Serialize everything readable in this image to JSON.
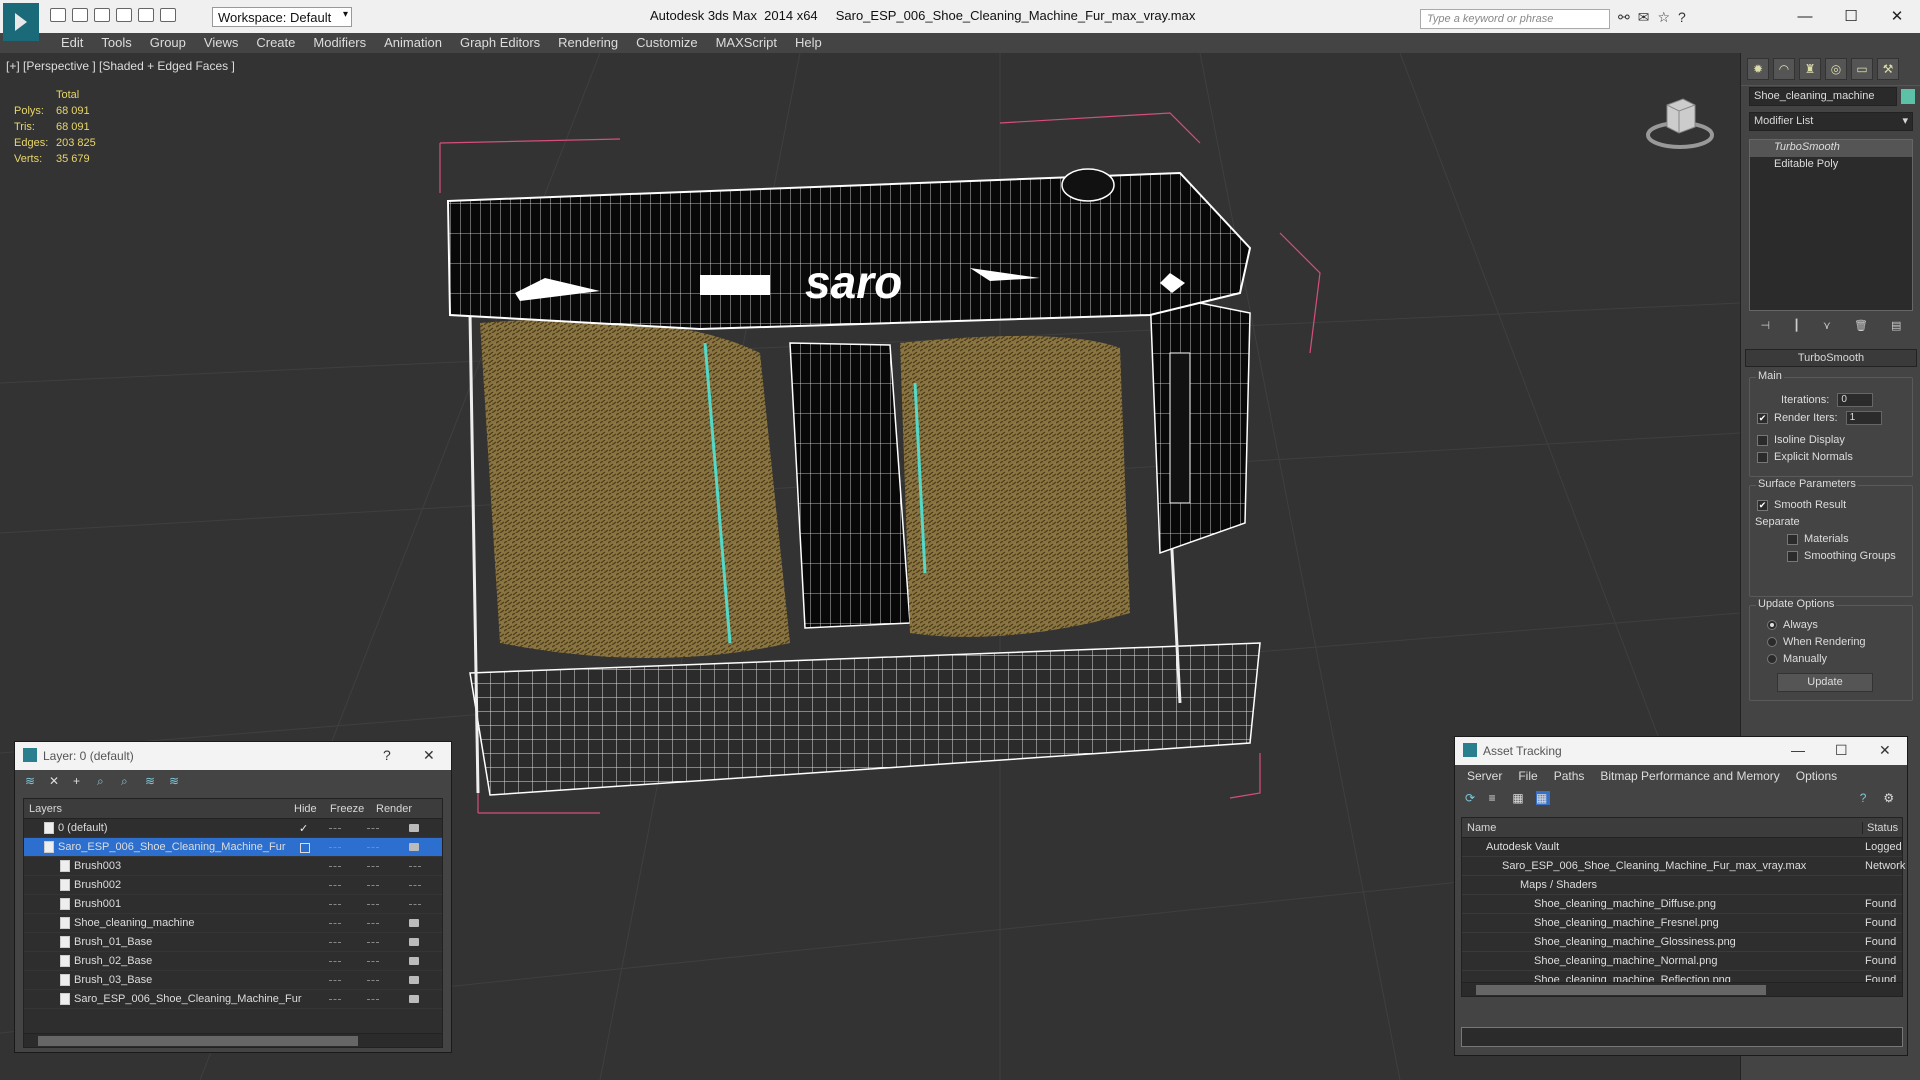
{
  "app": {
    "title": "Autodesk 3ds Max  2014 x64     Saro_ESP_006_Shoe_Cleaning_Machine_Fur_max_vray.max",
    "workspace": "Workspace: Default",
    "search_placeholder": "Type a keyword or phrase"
  },
  "menu": [
    "Edit",
    "Tools",
    "Group",
    "Views",
    "Create",
    "Modifiers",
    "Animation",
    "Graph Editors",
    "Rendering",
    "Customize",
    "MAXScript",
    "Help"
  ],
  "viewport": {
    "label": "[+] [Perspective ] [Shaded + Edged Faces ]",
    "stats": {
      "header": "Total",
      "rows": [
        {
          "k": "Polys:",
          "v": "68 091"
        },
        {
          "k": "Tris:",
          "v": "68 091"
        },
        {
          "k": "Edges:",
          "v": "203 825"
        },
        {
          "k": "Verts:",
          "v": "35 679"
        }
      ]
    },
    "logo_text": "saro"
  },
  "command_panel": {
    "object_name": "Shoe_cleaning_machine",
    "object_color": "#5cc1a6",
    "modifier_list": "Modifier List",
    "stack": [
      "TurboSmooth",
      "Editable Poly"
    ],
    "rollout": "TurboSmooth",
    "main_group": "Main",
    "iterations_label": "Iterations:",
    "iterations": "0",
    "render_iters_label": "Render Iters:",
    "render_iters": "1",
    "isoline": "Isoline Display",
    "explicit_normals": "Explicit Normals",
    "surface_group": "Surface Parameters",
    "smooth_result": "Smooth Result",
    "separate": "Separate",
    "materials": "Materials",
    "smoothing_groups": "Smoothing Groups",
    "update_group": "Update Options",
    "always": "Always",
    "when_rendering": "When Rendering",
    "manually": "Manually",
    "update_btn": "Update"
  },
  "layer_panel": {
    "title": "Layer: 0 (default)",
    "help": "?",
    "columns": [
      "Layers",
      "Hide",
      "Freeze",
      "Render"
    ],
    "rows": [
      "0 (default)",
      "Saro_ESP_006_Shoe_Cleaning_Machine_Fur",
      "Brush003",
      "Brush002",
      "Brush001",
      "Shoe_cleaning_machine",
      "Brush_01_Base",
      "Brush_02_Base",
      "Brush_03_Base",
      "Saro_ESP_006_Shoe_Cleaning_Machine_Fur"
    ]
  },
  "asset_panel": {
    "title": "Asset Tracking",
    "menu": [
      "Server",
      "File",
      "Paths",
      "Bitmap Performance and Memory",
      "Options"
    ],
    "columns": [
      "Name",
      "Status"
    ],
    "rows": [
      {
        "name": "Autodesk Vault",
        "status": "Logged"
      },
      {
        "name": "Saro_ESP_006_Shoe_Cleaning_Machine_Fur_max_vray.max",
        "status": "Network"
      },
      {
        "name": "Maps / Shaders",
        "status": ""
      },
      {
        "name": "Shoe_cleaning_machine_Diffuse.png",
        "status": "Found"
      },
      {
        "name": "Shoe_cleaning_machine_Fresnel.png",
        "status": "Found"
      },
      {
        "name": "Shoe_cleaning_machine_Glossiness.png",
        "status": "Found"
      },
      {
        "name": "Shoe_cleaning_machine_Normal.png",
        "status": "Found"
      },
      {
        "name": "Shoe_cleaning_machine_Reflection.png",
        "status": "Found"
      }
    ]
  }
}
